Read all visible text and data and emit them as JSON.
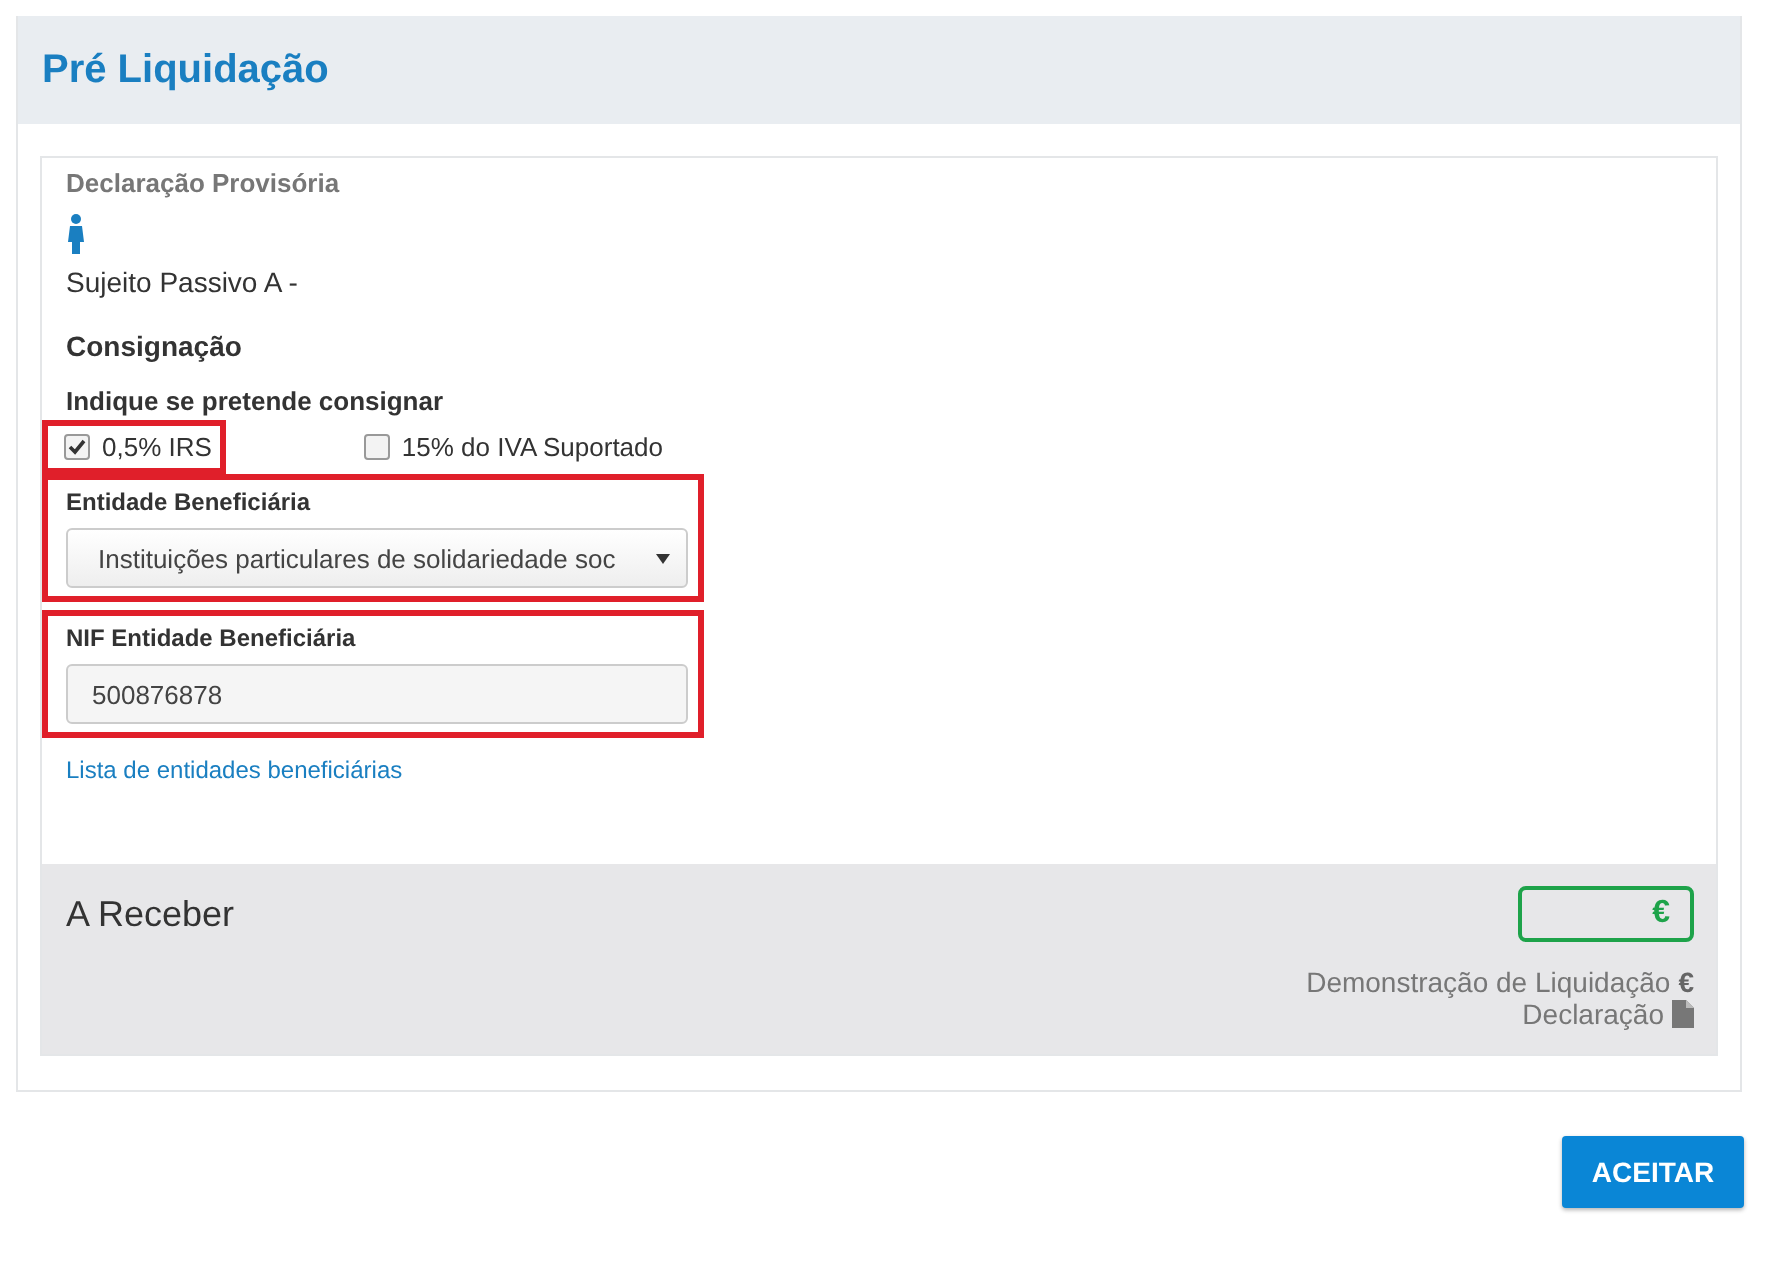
{
  "header": {
    "title": "Pré Liquidação"
  },
  "declaration": {
    "title": "Declaração Provisória",
    "taxpayer": "Sujeito Passivo A -"
  },
  "consignment": {
    "title": "Consignação",
    "question": "Indique se pretende consignar",
    "options": [
      {
        "label": "0,5% IRS",
        "checked": true,
        "highlighted": true
      },
      {
        "label": "15% do IVA Suportado",
        "checked": false,
        "highlighted": false
      }
    ],
    "entity": {
      "label": "Entidade Beneficiária",
      "value": "Instituições particulares de solidariedade soc",
      "highlighted": true
    },
    "nif": {
      "label": "NIF Entidade Beneficiária",
      "value": "500876878",
      "highlighted": true
    },
    "link": "Lista de entidades beneficiárias"
  },
  "summary": {
    "title": "A Receber",
    "amount_symbol": "€",
    "links": [
      {
        "label": "Demonstração de Liquidação",
        "kind": "euro",
        "symbol": "€"
      },
      {
        "label": "Declaração",
        "kind": "file"
      }
    ]
  },
  "buttons": [
    {
      "label": "ACEITAR"
    }
  ]
}
